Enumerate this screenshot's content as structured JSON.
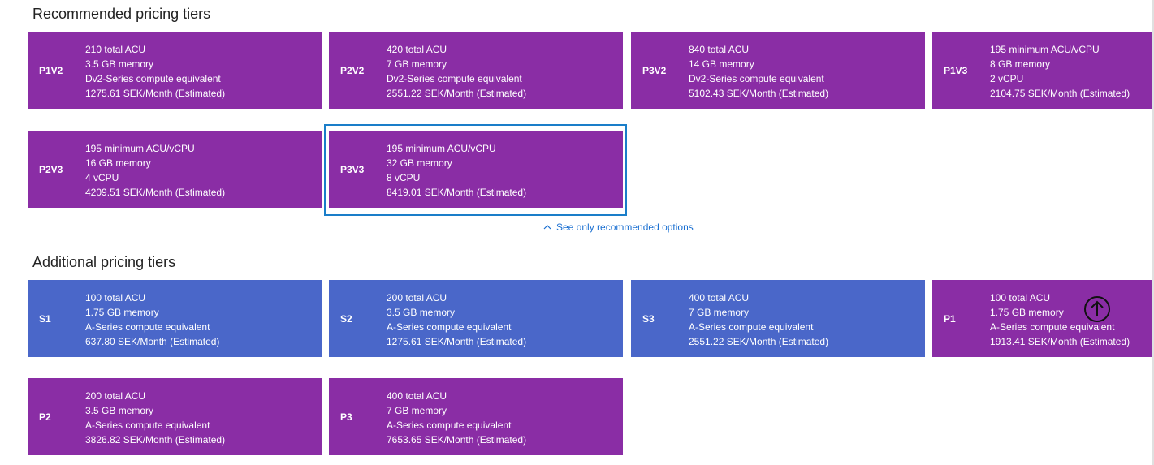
{
  "recommended": {
    "title": "Recommended pricing tiers",
    "tiers": [
      {
        "code": "P1V2",
        "lines": [
          "210 total ACU",
          "3.5 GB memory",
          "Dv2-Series compute equivalent",
          "1275.61 SEK/Month (Estimated)"
        ]
      },
      {
        "code": "P2V2",
        "lines": [
          "420 total ACU",
          "7 GB memory",
          "Dv2-Series compute equivalent",
          "2551.22 SEK/Month (Estimated)"
        ]
      },
      {
        "code": "P3V2",
        "lines": [
          "840 total ACU",
          "14 GB memory",
          "Dv2-Series compute equivalent",
          "5102.43 SEK/Month (Estimated)"
        ]
      },
      {
        "code": "P1V3",
        "lines": [
          "195 minimum ACU/vCPU",
          "8 GB memory",
          "2 vCPU",
          "2104.75 SEK/Month (Estimated)"
        ]
      },
      {
        "code": "P2V3",
        "lines": [
          "195 minimum ACU/vCPU",
          "16 GB memory",
          "4 vCPU",
          "4209.51 SEK/Month (Estimated)"
        ]
      },
      {
        "code": "P3V3",
        "lines": [
          "195 minimum ACU/vCPU",
          "32 GB memory",
          "8 vCPU",
          "8419.01 SEK/Month (Estimated)"
        ]
      }
    ],
    "selected_code": "P3V3",
    "toggle_label": "See only recommended options"
  },
  "additional": {
    "title": "Additional pricing tiers",
    "tiers": [
      {
        "code": "S1",
        "lines": [
          "100 total ACU",
          "1.75 GB memory",
          "A-Series compute equivalent",
          "637.80 SEK/Month (Estimated)"
        ]
      },
      {
        "code": "S2",
        "lines": [
          "200 total ACU",
          "3.5 GB memory",
          "A-Series compute equivalent",
          "1275.61 SEK/Month (Estimated)"
        ]
      },
      {
        "code": "S3",
        "lines": [
          "400 total ACU",
          "7 GB memory",
          "A-Series compute equivalent",
          "2551.22 SEK/Month (Estimated)"
        ]
      },
      {
        "code": "P1",
        "lines": [
          "100 total ACU",
          "1.75 GB memory",
          "A-Series compute equivalent",
          "1913.41 SEK/Month (Estimated)"
        ]
      },
      {
        "code": "P2",
        "lines": [
          "200 total ACU",
          "3.5 GB memory",
          "A-Series compute equivalent",
          "3826.82 SEK/Month (Estimated)"
        ]
      },
      {
        "code": "P3",
        "lines": [
          "400 total ACU",
          "7 GB memory",
          "A-Series compute equivalent",
          "7653.65 SEK/Month (Estimated)"
        ]
      }
    ]
  },
  "icons": {
    "toggle": "chevron-up-icon",
    "scroll": "arrow-up-circle-icon"
  },
  "colors": {
    "purple_tier": "#8a2da5",
    "blue_tier": "#4a67c9",
    "selection": "#1a7ec9",
    "link": "#1a6fd1"
  }
}
